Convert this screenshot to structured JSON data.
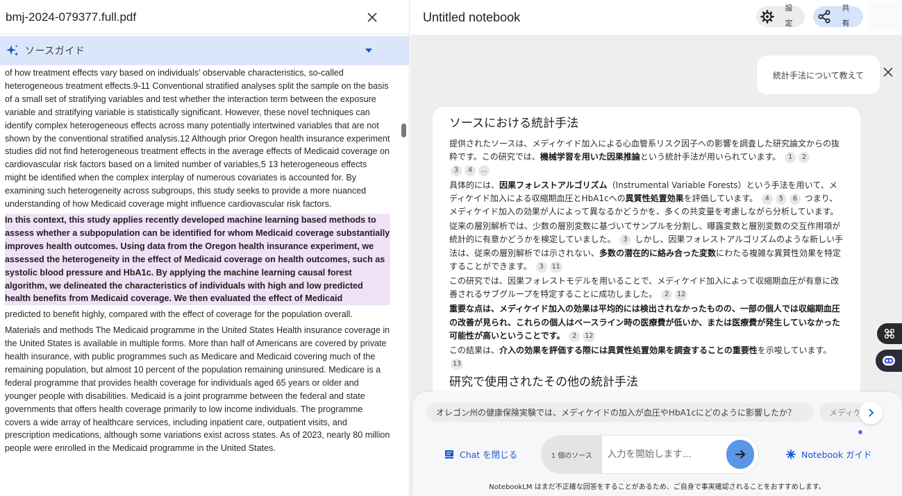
{
  "left_pane": {
    "file_title": "bmj-2024-079377.full.pdf",
    "source_guide_label": "ソースガイド",
    "paragraphs": [
      "of how treatment effects vary based on individuals’ observable characteristics, so-called heterogeneous treatment effects.9-11 Conventional stratified analyses split the sample on the basis of a small set of stratifying variables and test whether the interaction term between the exposure variable and stratifying variable is statistically significant. However, these novel techniques can identify complex heterogeneous effects across many potentially intertwined variables that are not shown by the conventional stratified analysis.12 Although prior Oregon health insurance experiment studies did not find heterogeneous treatment effects in the average effects of Medicaid coverage on cardiovascular risk factors based on a limited number of variables,5 13 heterogeneous effects might be identified when the complex interplay of numerous covariates is accounted for. By examining such heterogeneity across subgroups, this study seeks to provide a more nuanced understanding of how Medicaid coverage might influence cardiovascular risk factors.",
      "In this context, this study applies recently developed machine learning based methods to assess whether a subpopulation can be identified for whom Medicaid coverage substantially improves health outcomes. Using data from the Oregon health insurance experiment, we assessed the heterogeneity in the effect of Medicaid coverage on health outcomes, such as systolic blood pressure and HbA1c. By applying the machine learning causal forest algorithm, we delineated the characteristics of individuals with high and low predicted health benefits from Medicaid coverage. We then evaluated the effect of Medicaid",
      "predicted to benefit highly, compared with the effect of coverage for the population overall.",
      "Materials and methods The Medicaid programme in the United States Health insurance coverage in the United States is available in multiple forms. More than half of Americans are covered by private health insurance, with public programmes such as Medicare and Medicaid covering much of the remaining population, but almost 10 percent of the population remaining uninsured. Medicare is a federal programme that provides health coverage for individuals aged 65 years or older and younger people with disabilities. Medicaid is a joint programme between the federal and state governments that offers health coverage primarily to low income individuals. The programme covers a wide array of healthcare services, including inpatient care, outpatient visits, and prescription medications, although some variations exist across states. As of 2023, nearly 80 million people were enrolled in the Medicaid programme in the United States."
    ]
  },
  "right_pane": {
    "notebook_title": "Untitled notebook",
    "settings_label": "設定",
    "share_label": "共有",
    "user_query": "統計手法について教えて",
    "answer": {
      "title": "ソースにおける統計手法",
      "p1": {
        "a": "提供されたソースは、メディケイド加入による心血管系リスク因子への影響を調査した研究論文からの抜粋です。この研究では、",
        "b": "機械学習を用いた因果推論",
        "c": "という統計手法が用いられています。",
        "cites1": [
          "1",
          "2"
        ],
        "cites2": [
          "3",
          "4",
          "..."
        ]
      },
      "p2": {
        "a": "具体的には、",
        "b": "因果フォレストアルゴリズム",
        "c": "（Instrumental Variable Forests）という手法を用いて、メディケイド加入による収縮期血圧とHbA1cへの",
        "d": "異質性処置効果",
        "e": "を評価しています。",
        "cites": [
          "4",
          "5",
          "6"
        ],
        "f": "つまり、メディケイド加入の効果が人によって異なるかどうかを、多くの共変量を考慮しながら分析しています。"
      },
      "p3": {
        "a": "従来の層別解析では、少数の層別変数に基づいてサンプルを分割し、曝露変数と層別変数の交互作用項が統計的に有意かどうかを検定していました。",
        "cite_a": "3",
        "b": "しかし、因果フォレストアルゴリズムのような新しい手法は、従来の層別解析では示されない、",
        "c": "多数の潜在的に絡み合った変数",
        "d": "にわたる複雑な異質性効果を特定することができます。",
        "cites": [
          "3",
          "11"
        ]
      },
      "p4": {
        "a": "この研究では、因果フォレストモデルを用いることで、メディケイド加入によって収縮期血圧が有意に改善されるサブグループを特定することに成功しました。",
        "cites": [
          "2",
          "12"
        ]
      },
      "p5": {
        "a": "重要な点は、メディケイド加入の効果は平均的には検出されなかったものの、一部の個人では収縮期血圧の改善が見られ、これらの個人はベースライン時の医療費が低いか、または医療費が発生していなかった可能性が高いということです。",
        "cites": [
          "2",
          "12"
        ]
      },
      "p6": {
        "a": "この結果は、",
        "b": "介入の効果を評価する際には異質性処置効果を調査することの重要性",
        "c": "を示唆しています。",
        "cites": [
          "13"
        ]
      },
      "next_heading": "研究で使用されたその他の統計手法"
    },
    "composer": {
      "suggestion_1": "オレゴン州の健康保険実験では、メディケイドの加入が血圧やHbA1cにどのように影響したか？",
      "suggestion_2": "メディケ",
      "close_chat_label": "Chat を閉じる",
      "source_count": "1 個のソース",
      "input_placeholder": "入力を開始します...",
      "notebook_guide_label": "Notebook ガイド",
      "disclaimer": "NotebookLM はまだ不正確な回答をすることがあるため、ご自身で事実確認されることをおすすめします。"
    }
  },
  "icons": {
    "close": "close-icon",
    "sparkle": "sparkle-icon",
    "gear": "gear-icon",
    "share": "share-icon",
    "send": "arrow-right-icon",
    "chat": "chat-icon",
    "guide": "asterisk-icon"
  },
  "colors": {
    "guide_bar": "#dbe6fb",
    "highlight": "#f0e1f7",
    "accent_blue": "#1a56c9",
    "send_button": "#5a95e8"
  }
}
